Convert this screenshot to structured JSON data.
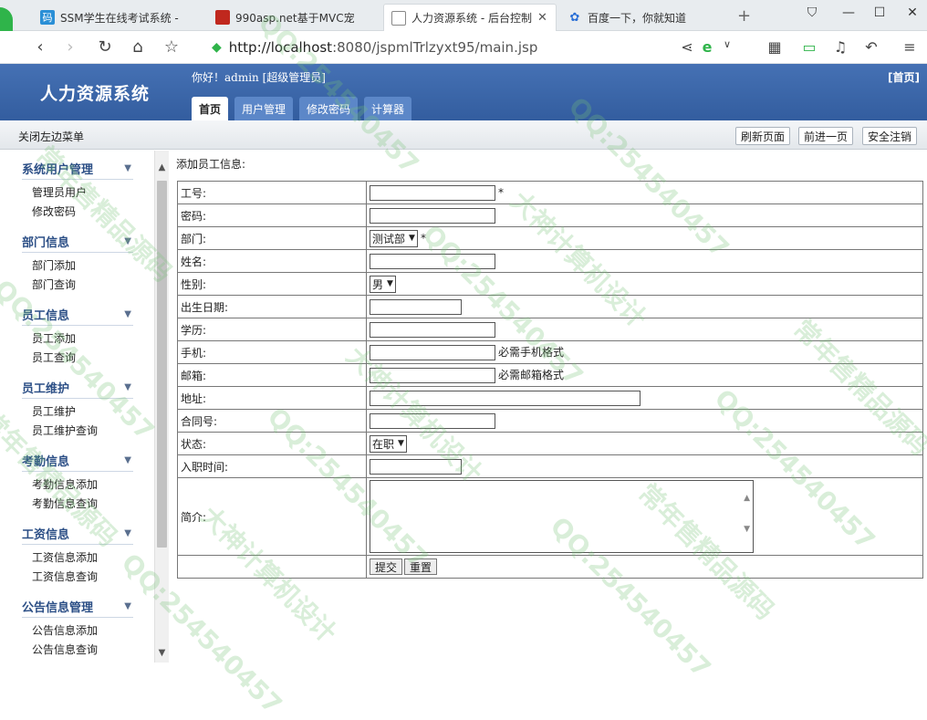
{
  "browser": {
    "tabs": [
      {
        "label": "SSM学生在线考试系统 -",
        "icon": "码"
      },
      {
        "label": "990asp.net基于MVC宠",
        "icon": "red-square"
      },
      {
        "label": "人力资源系统 - 后台控制",
        "icon": "page"
      },
      {
        "label": "百度一下，你就知道",
        "icon": "paw"
      }
    ],
    "url_host": "http://localhost",
    "url_rest": ":8080/jspmlTrlzyxt95/main.jsp"
  },
  "app": {
    "title": "人力资源系统",
    "welcome": "你好！admin [超级管理员]",
    "home_link": "[首页]",
    "nav": [
      "首页",
      "用户管理",
      "修改密码",
      "计算器"
    ]
  },
  "toolbar": {
    "toggle_menu": "关闭左边菜单",
    "refresh": "刷新页面",
    "forward": "前进一页",
    "logout": "安全注销"
  },
  "sidebar": {
    "groups": [
      {
        "title": "系统用户管理",
        "items": [
          "管理员用户",
          "修改密码"
        ]
      },
      {
        "title": "部门信息",
        "items": [
          "部门添加",
          "部门查询"
        ]
      },
      {
        "title": "员工信息",
        "items": [
          "员工添加",
          "员工查询"
        ]
      },
      {
        "title": "员工维护",
        "items": [
          "员工维护",
          "员工维护查询"
        ]
      },
      {
        "title": "考勤信息",
        "items": [
          "考勤信息添加",
          "考勤信息查询"
        ]
      },
      {
        "title": "工资信息",
        "items": [
          "工资信息添加",
          "工资信息查询"
        ]
      },
      {
        "title": "公告信息管理",
        "items": [
          "公告信息添加",
          "公告信息查询"
        ]
      }
    ]
  },
  "form": {
    "title": "添加员工信息:",
    "fields": {
      "emp_no": "工号:",
      "password": "密码:",
      "department": "部门:",
      "name": "姓名:",
      "gender": "性别:",
      "birthday": "出生日期:",
      "education": "学历:",
      "phone": "手机:",
      "email": "邮箱:",
      "address": "地址:",
      "contract": "合同号:",
      "status": "状态:",
      "hire_date": "入职时间:",
      "intro": "简介:"
    },
    "required_mark": "*",
    "department_value": "测试部",
    "gender_value": "男",
    "status_value": "在职",
    "phone_hint": "必需手机格式",
    "email_hint": "必需邮箱格式",
    "submit": "提交",
    "reset": "重置"
  },
  "watermark": {
    "qq": "QQ:254540457",
    "text1": "大神计算机设计",
    "text2": "常年售精品源码"
  }
}
